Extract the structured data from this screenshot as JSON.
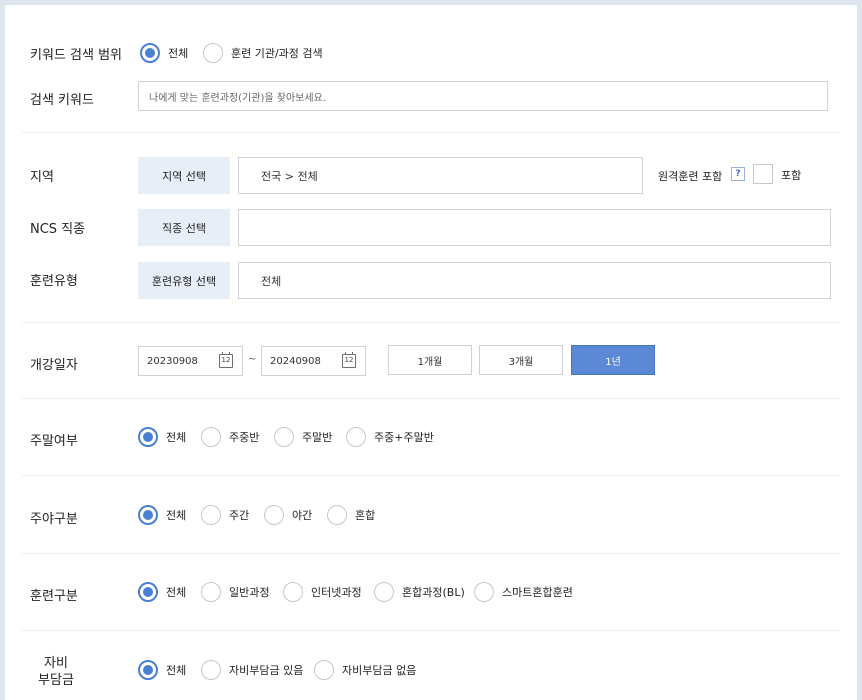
{
  "keyword_scope": {
    "label": "키워드 검색 범위",
    "options": [
      "전체",
      "훈련 기관/과정 검색"
    ],
    "selected": 0
  },
  "search_keyword": {
    "label": "검색 키워드",
    "placeholder": "나에게 맞는 훈련과정(기관)을 찾아보세요."
  },
  "region": {
    "label": "지역",
    "button": "지역 선택",
    "value": "전국 > 전체",
    "remote_label": "원격훈련 포함",
    "help": "?",
    "include_label": "포함"
  },
  "ncs": {
    "label": "NCS 직종",
    "button": "직종 선택",
    "value": ""
  },
  "training_type": {
    "label": "훈련유형",
    "button": "훈련유형 선택",
    "value": "전체"
  },
  "start_date": {
    "label": "개강일자",
    "from": "20230908",
    "to": "20240908",
    "separator": "~",
    "calendar_glyph": "12",
    "periods": [
      "1개월",
      "3개월",
      "1년"
    ],
    "active_period": 2
  },
  "weekend": {
    "label": "주말여부",
    "options": [
      "전체",
      "주중반",
      "주말반",
      "주중+주말반"
    ],
    "selected": 0
  },
  "day_night": {
    "label": "주야구분",
    "options": [
      "전체",
      "주간",
      "야간",
      "혼합"
    ],
    "selected": 0
  },
  "training_class": {
    "label": "훈련구분",
    "options": [
      "전체",
      "일반과정",
      "인터넷과정",
      "혼합과정(BL)",
      "스마트혼합훈련"
    ],
    "selected": 0
  },
  "self_pay": {
    "label_line1": "자비",
    "label_line2": "부담금",
    "options": [
      "전체",
      "자비부담금 있음",
      "자비부담금 없음"
    ],
    "selected": 0
  },
  "colors": {
    "accent": "#4a7fd4",
    "button_active": "#5b89d6",
    "select_bg": "#e8eef8"
  }
}
